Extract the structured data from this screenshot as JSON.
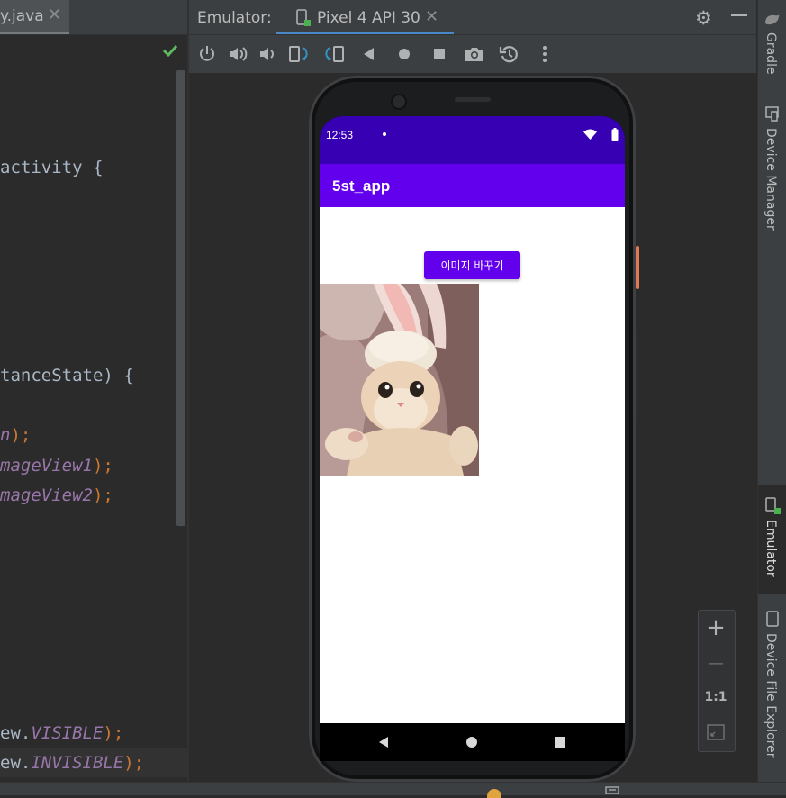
{
  "editor": {
    "tab_label": "y.java",
    "tab_close": "✕",
    "lines": {
      "activity": "activity {",
      "instance_state": "tanceState) {",
      "line_n": "n",
      "line_n_end": ");",
      "imageview1": "mageView1",
      "imageview1_end": ");",
      "imageview2": "mageView2",
      "imageview2_end": ");",
      "visible_prefix": "ew.",
      "visible": "VISIBLE",
      "visible_end": ");",
      "invisible_prefix": "ew.",
      "invisible": "INVISIBLE",
      "invisible_end": ");"
    }
  },
  "emulator": {
    "title": "Emulator:",
    "device_tab": "Pixel 4 API 30",
    "device_tab_close": "✕",
    "toolbar_icons": [
      "power-icon",
      "volume-up-icon",
      "volume-down-icon",
      "rotate-left-icon",
      "rotate-right-icon",
      "back-icon",
      "home-icon",
      "overview-icon",
      "camera-icon",
      "snapshot-icon",
      "more-icon"
    ]
  },
  "phone": {
    "status_time": "12:53",
    "app_title": "5st_app",
    "button_label": "이미지 바꾸기"
  },
  "zoom": {
    "plus": "+",
    "minus": "—",
    "one_to_one": "1:1"
  },
  "right_strip": {
    "gradle": "Gradle",
    "device_manager": "Device Manager",
    "emulator": "Emulator",
    "device_file_explorer": "Device File Explorer"
  },
  "colors": {
    "status_bar": "#3700b3",
    "app_bar": "#6200ee",
    "accent": "#4a88c7"
  }
}
